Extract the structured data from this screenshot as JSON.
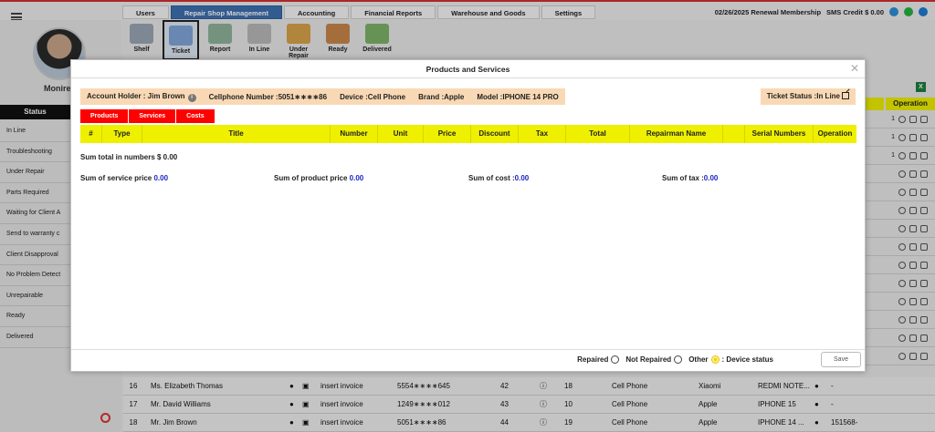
{
  "topbar": {
    "menu": [
      "Users",
      "Repair Shop Management",
      "Accounting",
      "Financial Reports",
      "Warehouse and Goods",
      "Settings"
    ],
    "renewal": "02/26/2025 Renewal Membership",
    "sms_credit": "SMS Credit $ 0.00"
  },
  "sidebar": {
    "username": "Monire",
    "status_title": "Status",
    "statuses": [
      "In Line",
      "Troubleshooting",
      "Under Repair",
      "Parts Required",
      "Waiting for Client A",
      "Send to warranty c",
      "Client Disapproval",
      "No Problem Detect",
      "Unrepairable",
      "Ready",
      "Delivered"
    ]
  },
  "toolbar": {
    "items": [
      "Shelf",
      "Ticket",
      "Report",
      "In Line",
      "Under Repair",
      "Ready",
      "Delivered"
    ]
  },
  "background_table": {
    "operation_header": "Operation",
    "row_partials": [
      "1",
      "1",
      "1",
      "",
      "",
      "",
      "",
      "",
      "",
      "",
      "",
      "",
      "",
      ""
    ],
    "rows": [
      {
        "no": "16",
        "name": "Ms. Elizabeth Thomas",
        "action": "insert invoice",
        "phone": "5554∗∗∗∗645",
        "a": "42",
        "b": "18",
        "device": "Cell Phone",
        "brand": "Xiaomi",
        "model": "REDMI NOTE...",
        "serial": "-"
      },
      {
        "no": "17",
        "name": "Mr. David Williams",
        "action": "insert invoice",
        "phone": "1249∗∗∗∗012",
        "a": "43",
        "b": "10",
        "device": "Cell Phone",
        "brand": "Apple",
        "model": "IPHONE 15",
        "serial": "-"
      },
      {
        "no": "18",
        "name": "Mr. Jim Brown",
        "action": "insert invoice",
        "phone": "5051∗∗∗∗86",
        "a": "44",
        "b": "19",
        "device": "Cell Phone",
        "brand": "Apple",
        "model": "IPHONE 14 ...",
        "serial": "151568-"
      }
    ]
  },
  "modal": {
    "title": "Products and Services",
    "info": {
      "account_holder": "Account Holder : Jim Brown",
      "cellphone": "Cellphone Number :5051∗∗∗∗86",
      "device": "Device :Cell Phone",
      "brand": "Brand :Apple",
      "model": "Model :IPHONE 14 PRO"
    },
    "ticket_status": "Ticket Status :In Line",
    "tabs": [
      "Products",
      "Services",
      "Costs"
    ],
    "columns": [
      "#",
      "Type",
      "Title",
      "Number",
      "Unit",
      "Price",
      "Discount",
      "Tax",
      "Total",
      "Repairman Name",
      "",
      "Serial Numbers",
      "Operation"
    ],
    "sum_total": "Sum total in numbers $ 0.00",
    "sums": [
      {
        "label": "Sum of service price ",
        "value": "0.00"
      },
      {
        "label": "Sum of product price ",
        "value": "0.00"
      },
      {
        "label": "Sum of cost :",
        "value": "0.00"
      },
      {
        "label": "Sum of tax :",
        "value": "0.00"
      }
    ],
    "device_status": {
      "options": [
        "Repaired",
        "Not Repaired",
        "Other"
      ],
      "label": ": Device status"
    },
    "save_label": "Save"
  }
}
